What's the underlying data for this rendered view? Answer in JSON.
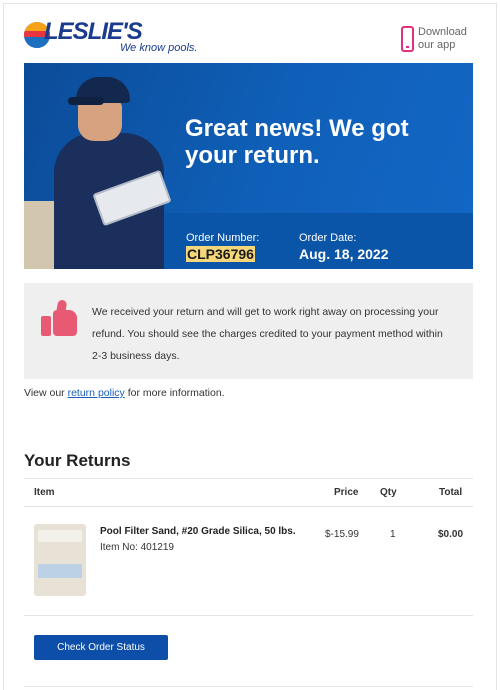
{
  "brand": {
    "name": "LESLIE'S",
    "tagline": "We know pools."
  },
  "app_promo": {
    "line1": "Download",
    "line2": "our app",
    "icon": "phone-icon"
  },
  "hero": {
    "headline": "Great news! We got your return.",
    "order_number_label": "Order Number:",
    "order_number": "CLP36796",
    "order_date_label": "Order Date:",
    "order_date": "Aug. 18, 2022"
  },
  "notice": {
    "icon": "thumbs-up-icon",
    "text": "We received your return and will get to work right away on processing your refund. You should see the charges credited to your payment method within 2-3 business days."
  },
  "policy": {
    "prefix": "View our ",
    "link": "return policy",
    "suffix": " for more information."
  },
  "returns": {
    "title": "Your Returns",
    "columns": {
      "item": "Item",
      "price": "Price",
      "qty": "Qty",
      "total": "Total"
    },
    "items": [
      {
        "name": "Pool Filter Sand, #20 Grade Silica, 50 lbs.",
        "item_no": "Item No: 401219",
        "price": "$-15.99",
        "qty": "1",
        "total": "$0.00"
      }
    ]
  },
  "actions": {
    "check_status": "Check Order Status"
  },
  "colors": {
    "brand_blue": "#0d4fa8",
    "hero_blue": "#0a4f9c",
    "highlight": "#f5d77a",
    "accent_pink": "#e85a74"
  }
}
